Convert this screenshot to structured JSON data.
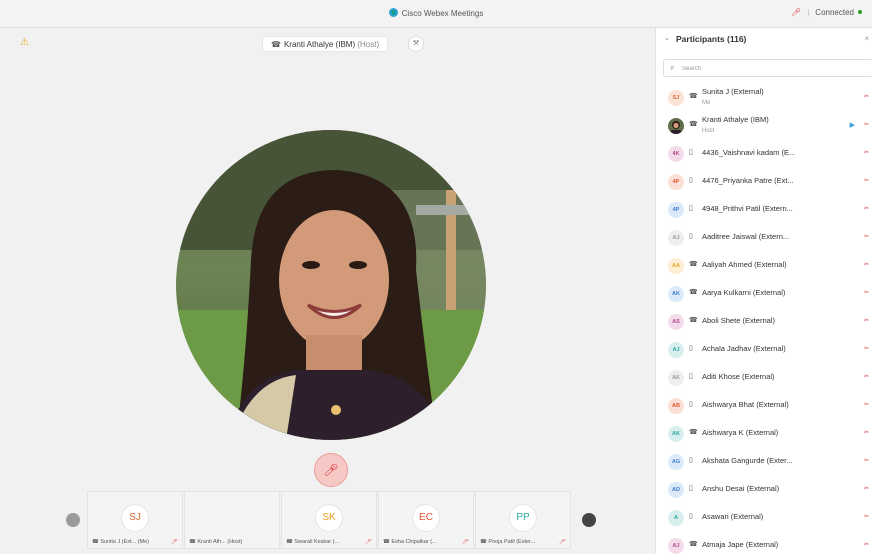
{
  "window": {
    "title": "Cisco Webex Meetings",
    "status": "Connected"
  },
  "stage": {
    "active_speaker": "Kranti Athalye (IBM)",
    "active_speaker_role": "(Host)"
  },
  "thumbnails": [
    {
      "initials": "SJ",
      "label": "Sunita J (Ext...",
      "tag": "(Me)",
      "color": "#e0682f"
    },
    {
      "initials": "",
      "label": "Kranti Ath...",
      "tag": "(Host)",
      "color": "#555555"
    },
    {
      "initials": "SK",
      "label": "Swarali Keskar (...",
      "tag": "",
      "color": "#e9a21f"
    },
    {
      "initials": "EC",
      "label": "Esha Chipalkar (...",
      "tag": "",
      "color": "#e3552f"
    },
    {
      "initials": "PP",
      "label": "Pooja Patil (Exter...",
      "tag": "",
      "color": "#2aa7a0"
    }
  ],
  "panel": {
    "title": "Participants (116)",
    "search_placeholder": "Search",
    "participants": [
      {
        "initials": "SJ",
        "name": "Sunita J (External)",
        "sub": "Me",
        "device": "phone",
        "color": "#e0682f",
        "bg": "#fbe3d7"
      },
      {
        "initials": "",
        "name": "Kranti Athalye (IBM)",
        "sub": "Host",
        "device": "phone",
        "color": "#555555",
        "bg": "#ffffff",
        "photo": true,
        "video": true
      },
      {
        "initials": "4K",
        "name": "4436_Vaishnavi kadam (E...",
        "sub": "",
        "device": "mobile",
        "color": "#b24a8f",
        "bg": "#f3dbe9"
      },
      {
        "initials": "4P",
        "name": "4476_Priyanka Patre (Ext...",
        "sub": "",
        "device": "mobile",
        "color": "#e3552f",
        "bg": "#fbe0d8"
      },
      {
        "initials": "4P",
        "name": "4948_Prithvi Patil (Extern...",
        "sub": "",
        "device": "mobile",
        "color": "#3b7fd0",
        "bg": "#dce9f8"
      },
      {
        "initials": "AJ",
        "name": "Aaditree Jaiswal (Extern...",
        "sub": "",
        "device": "mobile",
        "color": "#9a9a9a",
        "bg": "#eeeeee"
      },
      {
        "initials": "AA",
        "name": "Aaliyah Ahmed (External)",
        "sub": "",
        "device": "phone",
        "color": "#e9a21f",
        "bg": "#fcefd4"
      },
      {
        "initials": "AK",
        "name": "Aarya Kulkarni (External)",
        "sub": "",
        "device": "phone",
        "color": "#3b7fd0",
        "bg": "#dce9f8"
      },
      {
        "initials": "AS",
        "name": "Aboli Shete (External)",
        "sub": "",
        "device": "phone",
        "color": "#b24a8f",
        "bg": "#f3dbe9"
      },
      {
        "initials": "AJ",
        "name": "Achala Jadhav (External)",
        "sub": "",
        "device": "mobile",
        "color": "#2aa7a0",
        "bg": "#d7efed"
      },
      {
        "initials": "AK",
        "name": "Aditi Khose (External)",
        "sub": "",
        "device": "mobile",
        "color": "#9a9a9a",
        "bg": "#eeeeee"
      },
      {
        "initials": "AB",
        "name": "Aishwarya Bhat (External)",
        "sub": "",
        "device": "mobile",
        "color": "#e3552f",
        "bg": "#fbe0d8"
      },
      {
        "initials": "AK",
        "name": "Aishwarya K (External)",
        "sub": "",
        "device": "phone",
        "color": "#2aa7a0",
        "bg": "#d7efed"
      },
      {
        "initials": "AG",
        "name": "Akshata Gangurde (Exter...",
        "sub": "",
        "device": "mobile",
        "color": "#3b7fd0",
        "bg": "#dce9f8"
      },
      {
        "initials": "AD",
        "name": "Anshu Desai (External)",
        "sub": "",
        "device": "mobile",
        "color": "#3b7fd0",
        "bg": "#dce9f8"
      },
      {
        "initials": "A",
        "name": "Asawari (External)",
        "sub": "",
        "device": "mobile",
        "color": "#2aa7a0",
        "bg": "#d7efed"
      },
      {
        "initials": "AJ",
        "name": "Atmaja Jape (External)",
        "sub": "",
        "device": "phone",
        "color": "#b24a8f",
        "bg": "#f3dbe9"
      }
    ]
  }
}
